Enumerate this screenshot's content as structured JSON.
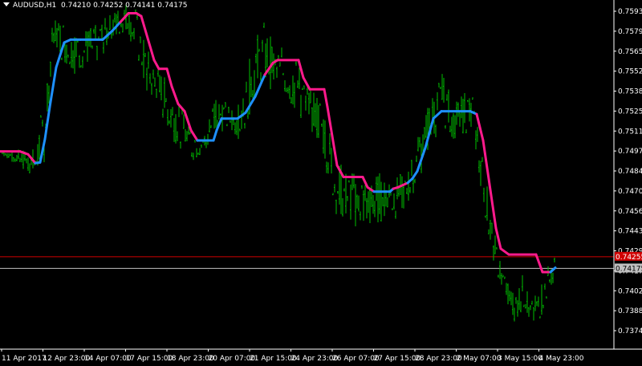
{
  "header": {
    "symbol": "AUDUSD,H1",
    "ohlc": "0.74210 0.74252 0.74141 0.74175"
  },
  "colors": {
    "background": "#000000",
    "bars": "#00c000",
    "ma_up": "#1e90ff",
    "ma_down": "#ff1a8c",
    "bid_line": "#c0c0c0",
    "ask_line": "#d00000",
    "axis": "#ffffff"
  },
  "chart_data": {
    "type": "line",
    "symbol": "AUDUSD",
    "timeframe": "H1",
    "price_axis": {
      "ticks": [
        "0.75934",
        "0.75797",
        "0.75656",
        "0.75524",
        "0.75384",
        "0.75252",
        "0.75114",
        "0.74979",
        "0.74844",
        "0.74709",
        "0.74565",
        "0.74434",
        "0.74299",
        "0.74170",
        "0.74024",
        "0.73889",
        "0.73749"
      ],
      "ylim": [
        0.7373,
        0.7601
      ]
    },
    "time_axis": {
      "ticks": [
        "11 Apr 2017",
        "12 Apr 23:00",
        "14 Apr 07:00",
        "17 Apr 15:00",
        "18 Apr 23:00",
        "20 Apr 07:00",
        "21 Apr 15:00",
        "24 Apr 23:00",
        "26 Apr 07:00",
        "27 Apr 15:00",
        "28 Apr 23:00",
        "2 May 07:00",
        "3 May 15:00",
        "4 May 23:00"
      ]
    },
    "price_lines": {
      "ask": {
        "value": 0.74255,
        "label": "0.74255"
      },
      "bid": {
        "value": 0.74175,
        "label": "0.74175"
      }
    },
    "moving_average": {
      "points": [
        [
          0,
          0.74975
        ],
        [
          25,
          0.74975
        ],
        [
          35,
          0.74955
        ],
        [
          44,
          0.74895
        ],
        [
          50,
          0.749
        ],
        [
          56,
          0.7506
        ],
        [
          62,
          0.7528
        ],
        [
          70,
          0.7555
        ],
        [
          80,
          0.7572
        ],
        [
          88,
          0.7574
        ],
        [
          100,
          0.7574
        ],
        [
          128,
          0.7574
        ],
        [
          132,
          0.7576
        ],
        [
          140,
          0.758
        ],
        [
          150,
          0.7586
        ],
        [
          160,
          0.7592
        ],
        [
          170,
          0.7592
        ],
        [
          176,
          0.759
        ],
        [
          184,
          0.7575
        ],
        [
          192,
          0.756
        ],
        [
          198,
          0.7554
        ],
        [
          208,
          0.7554
        ],
        [
          214,
          0.7542
        ],
        [
          222,
          0.753
        ],
        [
          230,
          0.7525
        ],
        [
          238,
          0.7512
        ],
        [
          246,
          0.7505
        ],
        [
          266,
          0.7505
        ],
        [
          270,
          0.7512
        ],
        [
          276,
          0.752
        ],
        [
          296,
          0.752
        ],
        [
          306,
          0.7524
        ],
        [
          318,
          0.7535
        ],
        [
          330,
          0.755
        ],
        [
          340,
          0.7558
        ],
        [
          346,
          0.756
        ],
        [
          372,
          0.756
        ],
        [
          378,
          0.7548
        ],
        [
          386,
          0.754
        ],
        [
          404,
          0.754
        ],
        [
          408,
          0.7528
        ],
        [
          414,
          0.7508
        ],
        [
          420,
          0.7488
        ],
        [
          428,
          0.748
        ],
        [
          452,
          0.748
        ],
        [
          458,
          0.7473
        ],
        [
          466,
          0.747
        ],
        [
          486,
          0.747
        ],
        [
          490,
          0.7472
        ],
        [
          496,
          0.7473
        ],
        [
          508,
          0.7476
        ],
        [
          514,
          0.7479
        ],
        [
          520,
          0.7484
        ],
        [
          530,
          0.75
        ],
        [
          540,
          0.752
        ],
        [
          550,
          0.7525
        ],
        [
          586,
          0.7525
        ],
        [
          594,
          0.7523
        ],
        [
          602,
          0.7505
        ],
        [
          610,
          0.7475
        ],
        [
          618,
          0.7445
        ],
        [
          624,
          0.7431
        ],
        [
          634,
          0.7427
        ],
        [
          668,
          0.7427
        ],
        [
          676,
          0.7415
        ],
        [
          686,
          0.7415
        ],
        [
          692,
          0.7418
        ]
      ],
      "direction": [
        "down",
        "down",
        "down",
        "up",
        "up",
        "up",
        "up",
        "up",
        "up",
        "up",
        "up",
        "up",
        "up",
        "up",
        "down",
        "down",
        "down",
        "down",
        "down",
        "down",
        "down",
        "down",
        "down",
        "down",
        "down",
        "down",
        "up",
        "up",
        "up",
        "up",
        "up",
        "up",
        "up",
        "down",
        "down",
        "down",
        "down",
        "down",
        "down",
        "down",
        "down",
        "down",
        "down",
        "down",
        "down",
        "down",
        "up",
        "up",
        "down",
        "down",
        "up",
        "up",
        "up",
        "up",
        "up",
        "up",
        "up",
        "down",
        "down",
        "down",
        "down",
        "down",
        "down",
        "down",
        "down",
        "up",
        "up"
      ]
    },
    "price_envelope": {
      "points": [
        [
          0,
          0.7498,
          0.7496
        ],
        [
          25,
          0.7499,
          0.7486
        ],
        [
          44,
          0.75,
          0.7478
        ],
        [
          56,
          0.754,
          0.749
        ],
        [
          66,
          0.759,
          0.757
        ],
        [
          76,
          0.7588,
          0.756
        ],
        [
          92,
          0.7584,
          0.755
        ],
        [
          110,
          0.7582,
          0.7556
        ],
        [
          122,
          0.7585,
          0.7558
        ],
        [
          138,
          0.7592,
          0.757
        ],
        [
          156,
          0.76,
          0.758
        ],
        [
          170,
          0.7596,
          0.7564
        ],
        [
          182,
          0.757,
          0.7535
        ],
        [
          196,
          0.7556,
          0.753
        ],
        [
          210,
          0.7545,
          0.7508
        ],
        [
          224,
          0.753,
          0.75
        ],
        [
          240,
          0.7515,
          0.749
        ],
        [
          258,
          0.7515,
          0.7495
        ],
        [
          268,
          0.754,
          0.7512
        ],
        [
          284,
          0.753,
          0.751
        ],
        [
          300,
          0.753,
          0.7505
        ],
        [
          316,
          0.7575,
          0.753
        ],
        [
          330,
          0.7588,
          0.754
        ],
        [
          344,
          0.7568,
          0.754
        ],
        [
          360,
          0.757,
          0.753
        ],
        [
          372,
          0.756,
          0.752
        ],
        [
          386,
          0.754,
          0.751
        ],
        [
          400,
          0.7535,
          0.75
        ],
        [
          408,
          0.752,
          0.748
        ],
        [
          418,
          0.75,
          0.7455
        ],
        [
          428,
          0.7485,
          0.745
        ],
        [
          444,
          0.7485,
          0.7445
        ],
        [
          462,
          0.748,
          0.7445
        ],
        [
          478,
          0.7485,
          0.745
        ],
        [
          492,
          0.748,
          0.745
        ],
        [
          508,
          0.7485,
          0.746
        ],
        [
          524,
          0.7515,
          0.748
        ],
        [
          536,
          0.7535,
          0.75
        ],
        [
          552,
          0.7552,
          0.7515
        ],
        [
          566,
          0.753,
          0.7505
        ],
        [
          580,
          0.754,
          0.751
        ],
        [
          590,
          0.7535,
          0.7505
        ],
        [
          600,
          0.75,
          0.747
        ],
        [
          610,
          0.7465,
          0.743
        ],
        [
          620,
          0.743,
          0.741
        ],
        [
          632,
          0.741,
          0.739
        ],
        [
          642,
          0.74,
          0.738
        ],
        [
          652,
          0.7415,
          0.739
        ],
        [
          662,
          0.7395,
          0.7376
        ],
        [
          672,
          0.7405,
          0.738
        ],
        [
          682,
          0.742,
          0.7395
        ],
        [
          692,
          0.7426,
          0.741
        ]
      ]
    }
  }
}
